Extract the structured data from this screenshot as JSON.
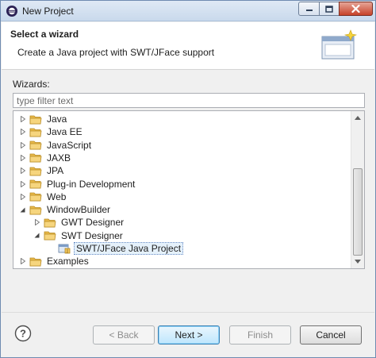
{
  "window": {
    "title": "New Project"
  },
  "header": {
    "title": "Select a wizard",
    "description": "Create a Java project with SWT/JFace support"
  },
  "wizards": {
    "label": "Wizards:",
    "filter_placeholder": "type filter text",
    "filter_value": ""
  },
  "tree": {
    "items": [
      {
        "label": "Java",
        "level": 0,
        "expanded": false,
        "icon": "folder-icon"
      },
      {
        "label": "Java EE",
        "level": 0,
        "expanded": false,
        "icon": "folder-icon"
      },
      {
        "label": "JavaScript",
        "level": 0,
        "expanded": false,
        "icon": "folder-icon"
      },
      {
        "label": "JAXB",
        "level": 0,
        "expanded": false,
        "icon": "folder-icon"
      },
      {
        "label": "JPA",
        "level": 0,
        "expanded": false,
        "icon": "folder-icon"
      },
      {
        "label": "Plug-in Development",
        "level": 0,
        "expanded": false,
        "icon": "folder-icon"
      },
      {
        "label": "Web",
        "level": 0,
        "expanded": false,
        "icon": "folder-icon"
      },
      {
        "label": "WindowBuilder",
        "level": 0,
        "expanded": true,
        "icon": "folder-icon"
      },
      {
        "label": "GWT Designer",
        "level": 1,
        "expanded": false,
        "icon": "folder-icon"
      },
      {
        "label": "SWT Designer",
        "level": 1,
        "expanded": true,
        "icon": "folder-icon"
      },
      {
        "label": "SWT/JFace Java Project",
        "level": 2,
        "leaf": true,
        "selected": true,
        "icon": "java-project-icon"
      },
      {
        "label": "Examples",
        "level": 0,
        "expanded": false,
        "icon": "folder-icon"
      }
    ]
  },
  "buttons": {
    "back": "< Back",
    "next": "Next >",
    "finish": "Finish",
    "cancel": "Cancel"
  },
  "colors": {
    "selection_bg": "#e5f1fb",
    "folder_yellow": "#f2c75c",
    "close_red": "#c7432a"
  }
}
